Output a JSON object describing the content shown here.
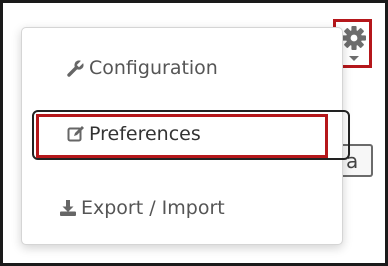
{
  "menu": {
    "configuration_label": "Configuration",
    "preferences_label": "Preferences",
    "export_import_label": "Export / Import"
  },
  "background": {
    "partial_button_text": "a"
  },
  "colors": {
    "highlight_red": "#b5171b",
    "menu_text": "#555555",
    "icon_gray": "#666666"
  },
  "icons": {
    "settings": "gear-icon",
    "configuration": "wrench-icon",
    "preferences": "edit-icon",
    "export_import": "download-icon"
  }
}
